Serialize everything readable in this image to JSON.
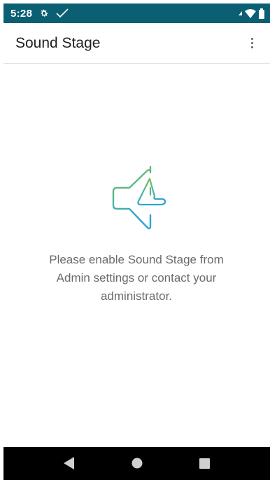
{
  "status_bar": {
    "time": "5:28",
    "icons": [
      "gear-icon",
      "check-icon",
      "signal-icon",
      "wifi-icon",
      "battery-icon"
    ],
    "background": "#0b5f73"
  },
  "app_bar": {
    "title": "Sound Stage",
    "menu_icon": "overflow-menu-icon"
  },
  "content": {
    "illustration": "speaker-warning-icon",
    "message": "Please enable Sound Stage from Admin settings or contact your administrator."
  },
  "nav_bar": {
    "buttons": [
      "back-icon",
      "home-icon",
      "recents-icon"
    ]
  },
  "colors": {
    "accent_green": "#7fc241",
    "accent_blue": "#2fa3d4",
    "message_text": "#6b6b6b"
  }
}
